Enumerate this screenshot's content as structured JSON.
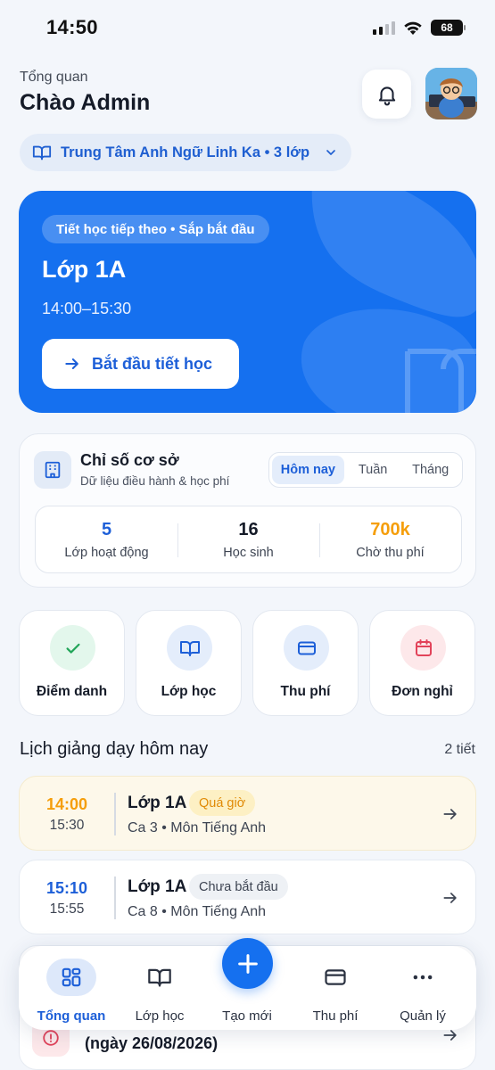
{
  "status_bar": {
    "time": "14:50",
    "battery": "68"
  },
  "header": {
    "subtitle": "Tổng quan",
    "greeting": "Chào Admin"
  },
  "center_selector": {
    "label": "Trung Tâm Anh Ngữ Linh Ka • 3 lớp"
  },
  "next_lesson": {
    "badge": "Tiết học tiếp theo • Sắp bắt đầu",
    "class_name": "Lớp 1A",
    "time_range": "14:00–15:30",
    "start_button": "Bắt đầu tiết học"
  },
  "stats": {
    "title": "Chỉ số cơ sở",
    "subtitle": "Dữ liệu điều hành & học phí",
    "tabs": [
      "Hôm nay",
      "Tuần",
      "Tháng"
    ],
    "active_tab": "Hôm nay",
    "metrics": [
      {
        "value": "5",
        "label": "Lớp hoạt động",
        "color": "#1d5fd8"
      },
      {
        "value": "16",
        "label": "Học sinh",
        "color": "#151b28"
      },
      {
        "value": "700k",
        "label": "Chờ thu phí",
        "color": "#f59e0b"
      }
    ]
  },
  "quick_actions": [
    {
      "label": "Điểm danh",
      "icon": "check-icon",
      "bg": "#e3f7ec",
      "color": "#22a559"
    },
    {
      "label": "Lớp học",
      "icon": "book-icon",
      "bg": "#e4edfb",
      "color": "#1d5fd8"
    },
    {
      "label": "Thu phí",
      "icon": "card-icon",
      "bg": "#e4edfb",
      "color": "#1d5fd8"
    },
    {
      "label": "Đơn nghỉ",
      "icon": "calendar-icon",
      "bg": "#fde8ea",
      "color": "#e2435a"
    }
  ],
  "schedule": {
    "title": "Lịch giảng dạy hôm nay",
    "count": "2 tiết",
    "lessons": [
      {
        "start": "14:00",
        "end": "15:30",
        "class_name": "Lớp 1A",
        "status": "Quá giờ",
        "meta": "Ca 3 • Môn Tiếng Anh",
        "start_color": "#f59e0b"
      },
      {
        "start": "15:10",
        "end": "15:55",
        "class_name": "Lớp 1A",
        "status": "Chưa bắt đầu",
        "meta": "Ca 8 • Môn Tiếng Anh",
        "start_color": "#1d5fd8"
      }
    ]
  },
  "partial_card": {
    "text": "(ngày 26/08/2026)"
  },
  "bottom_nav": {
    "items": [
      "Tổng quan",
      "Lớp học",
      "Tạo mới",
      "Thu phí",
      "Quản lý"
    ],
    "active": "Tổng quan"
  }
}
